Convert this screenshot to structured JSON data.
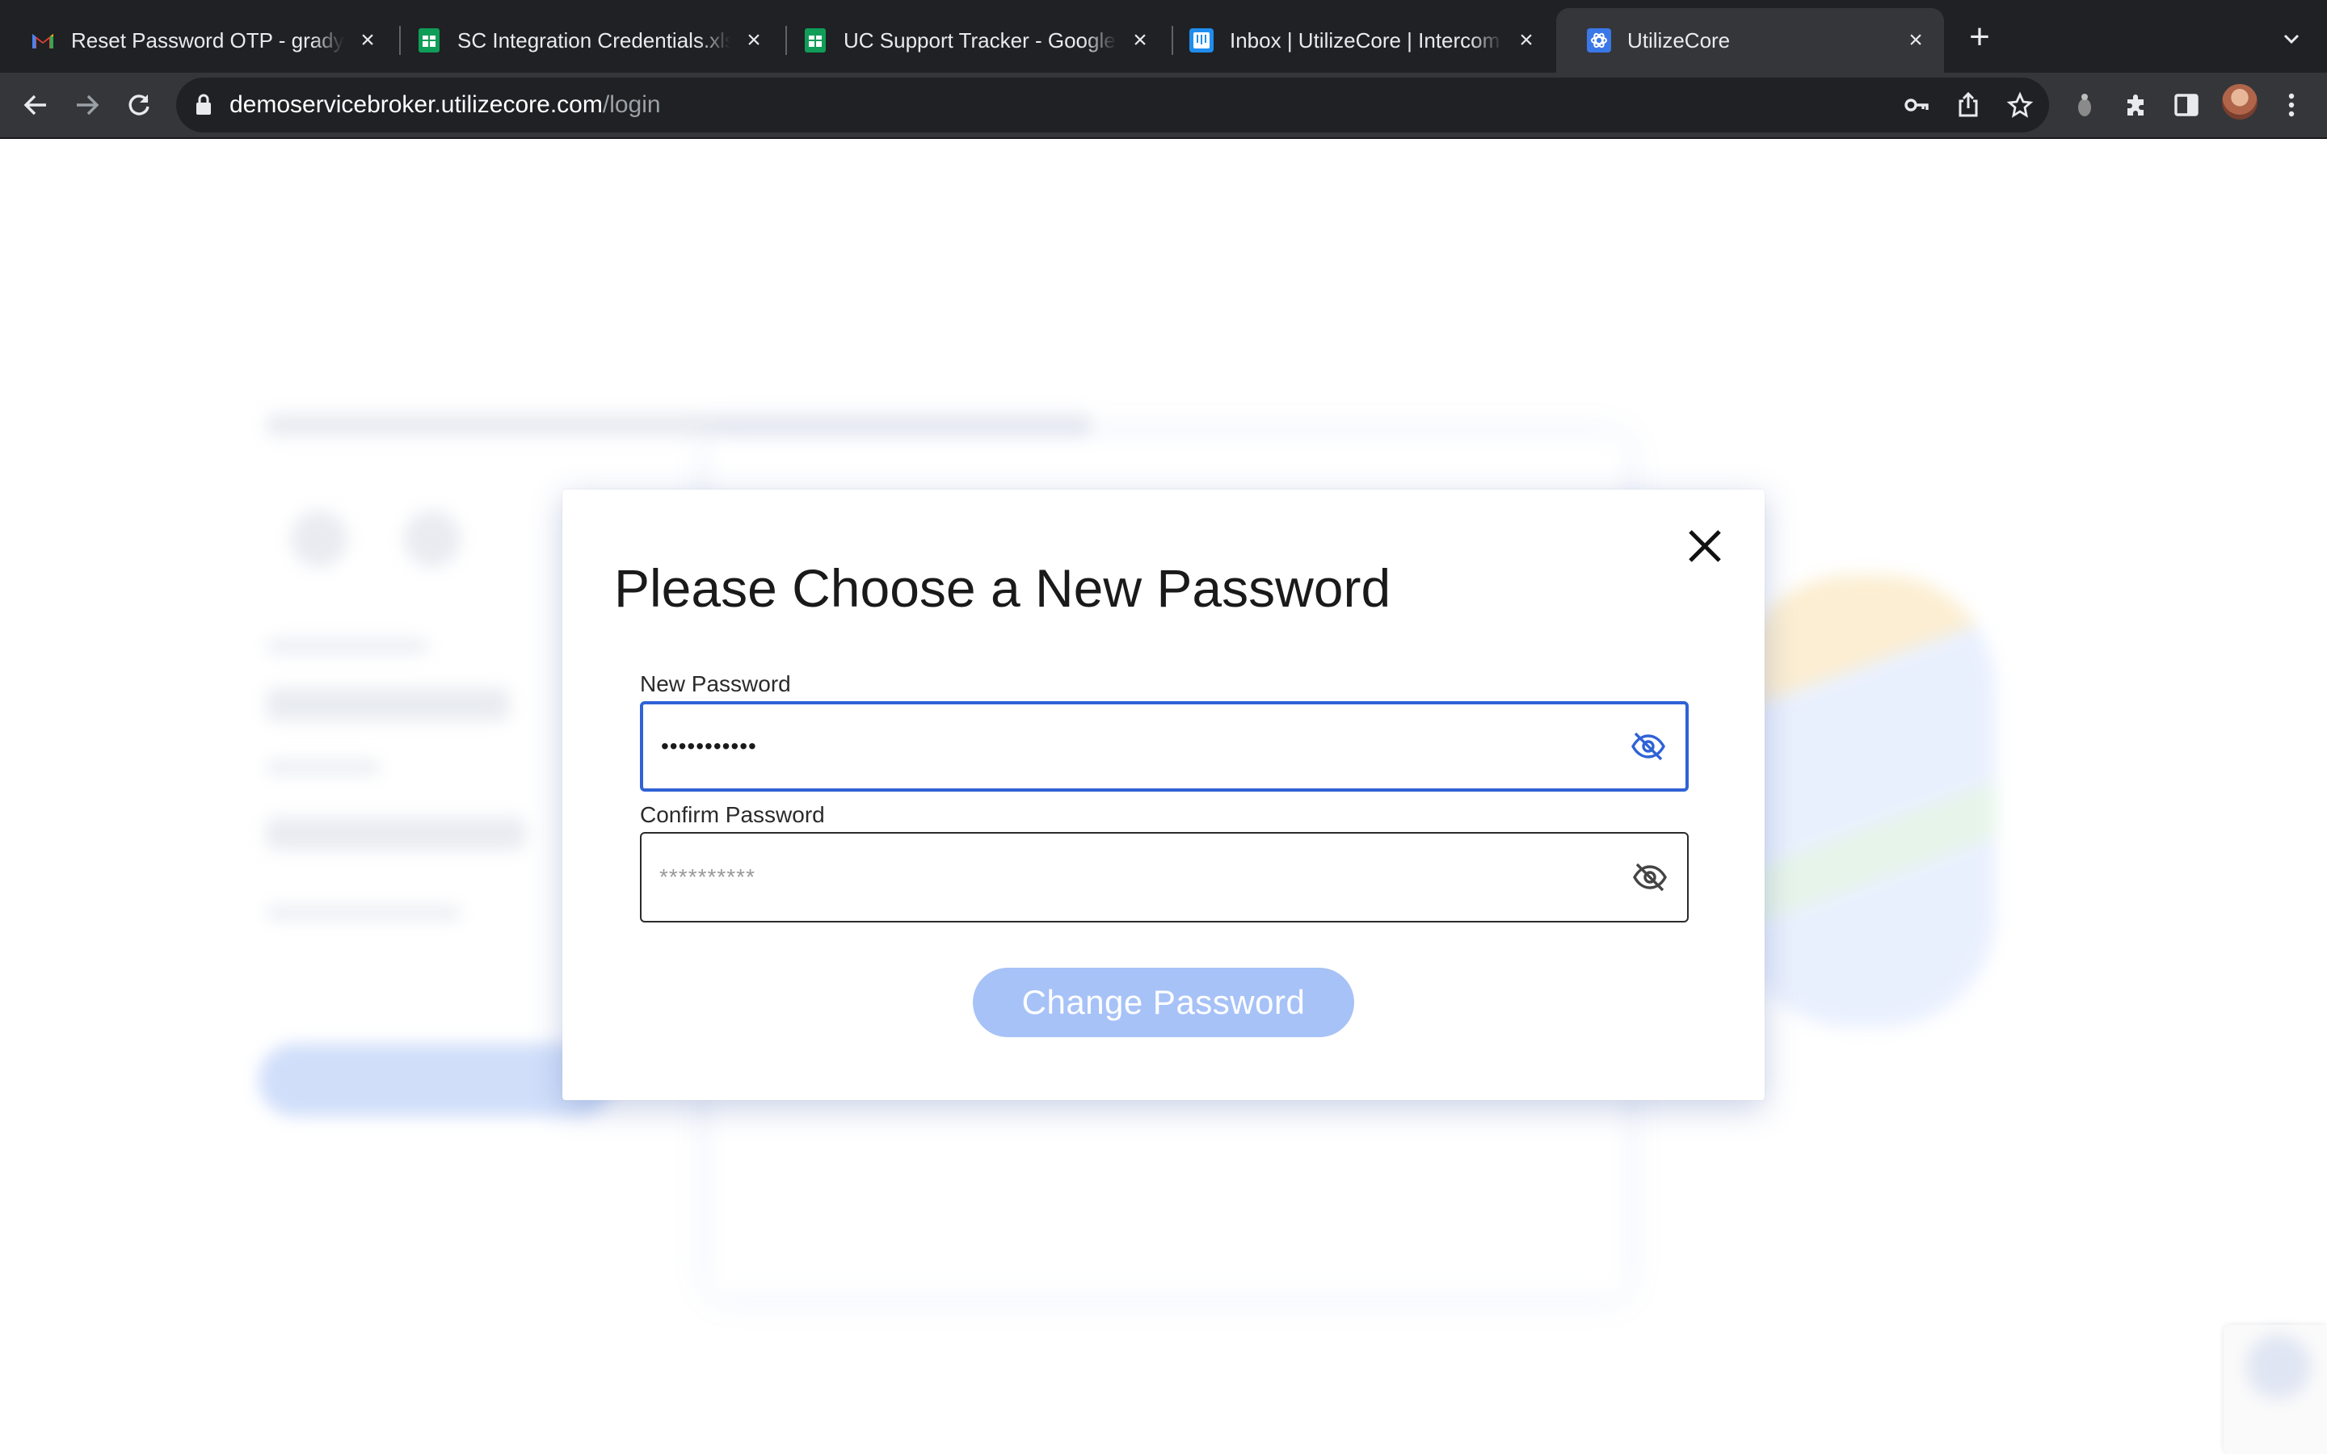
{
  "browser": {
    "tabs": [
      {
        "title": "Reset Password OTP - grady@",
        "favicon": "gmail-icon",
        "active": false
      },
      {
        "title": "SC Integration Credentials.xlsx",
        "favicon": "sheets-icon",
        "active": false
      },
      {
        "title": "UC Support Tracker - Google Sheets",
        "favicon": "sheets-icon",
        "active": false
      },
      {
        "title": "Inbox | UtilizeCore | Intercom",
        "favicon": "intercom-icon",
        "active": false
      },
      {
        "title": "UtilizeCore",
        "favicon": "utilizecore-icon",
        "active": true
      }
    ],
    "url": {
      "host": "demoservicebroker.utilizecore.com",
      "path": "/login"
    }
  },
  "modal": {
    "title": "Please Choose a New Password",
    "new_password": {
      "label": "New Password",
      "value": "•••••••••••",
      "focused": true
    },
    "confirm_password": {
      "label": "Confirm Password",
      "placeholder": "**********",
      "value": ""
    },
    "submit_label": "Change Password"
  },
  "colors": {
    "focus_border": "#2f62d6",
    "button_disabled": "#a7c2f7",
    "chrome_dark": "#202124",
    "chrome_toolbar": "#35363a"
  }
}
